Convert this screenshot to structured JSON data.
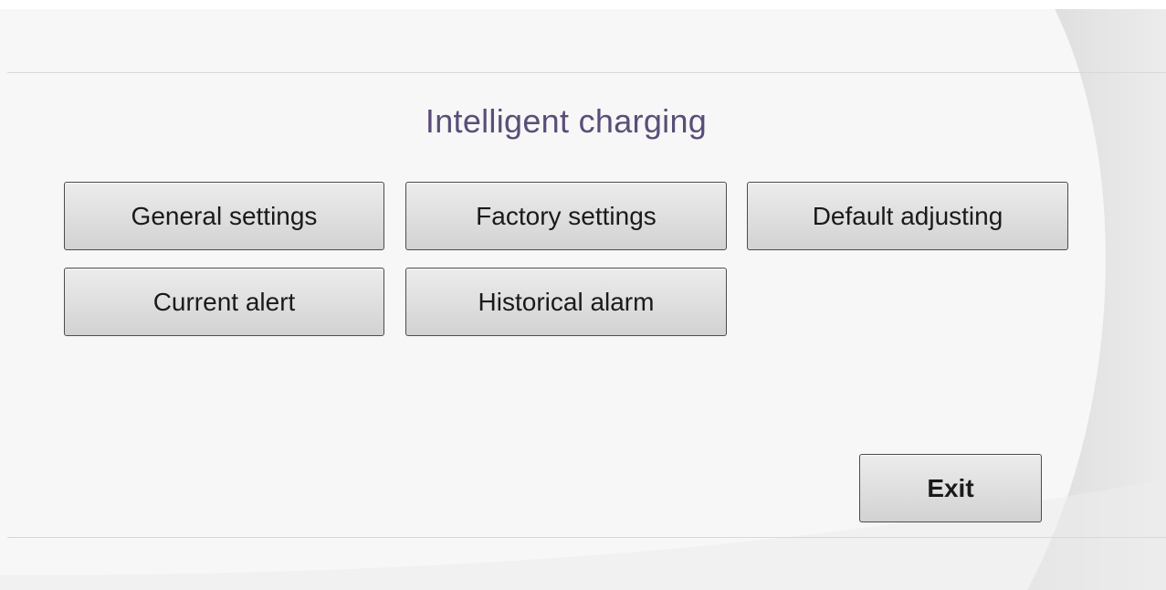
{
  "header": {
    "title": "Intelligent charging"
  },
  "menu": {
    "general_settings": "General settings",
    "factory_settings": "Factory settings",
    "default_adjusting": "Default adjusting",
    "current_alert": "Current alert",
    "historical_alarm": "Historical alarm"
  },
  "footer": {
    "exit": "Exit"
  },
  "colors": {
    "title": "#5a4e78",
    "background": "#f7f7f7",
    "button_face": "#dedede",
    "button_border": "#4c4c4c"
  }
}
